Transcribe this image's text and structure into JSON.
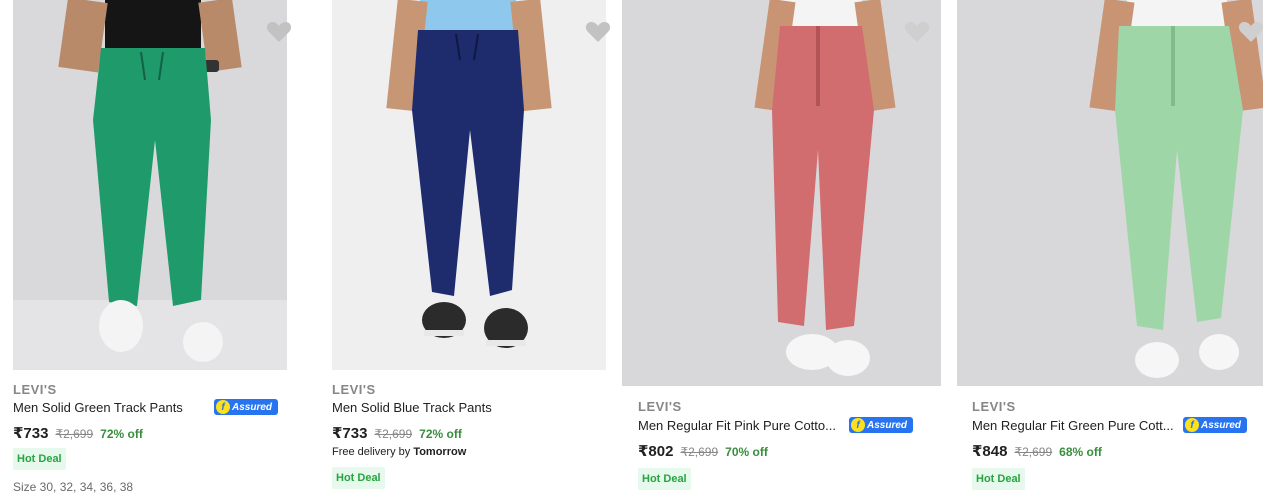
{
  "products": [
    {
      "brand": "LEVI'S",
      "title": "Men Solid Green Track Pants",
      "price": "₹733",
      "mrp": "₹2,699",
      "discount": "72% off",
      "assured": true,
      "deal": "Hot Deal",
      "sizes": "Size 30, 32, 34, 36, 38",
      "pant_color": "#1f9a6a"
    },
    {
      "brand": "LEVI'S",
      "title": "Men Solid Blue Track Pants",
      "price": "₹733",
      "mrp": "₹2,699",
      "discount": "72% off",
      "assured": false,
      "delivery_prefix": "Free delivery by ",
      "delivery_day": "Tomorrow",
      "deal": "Hot Deal",
      "pant_color": "#1e2c6e"
    },
    {
      "brand": "LEVI'S",
      "title": "Men Regular Fit Pink Pure Cotto...",
      "price": "₹802",
      "mrp": "₹2,699",
      "discount": "70% off",
      "assured": true,
      "deal": "Hot Deal",
      "pant_color": "#d26d6f"
    },
    {
      "brand": "LEVI'S",
      "title": "Men Regular Fit Green Pure Cott...",
      "price": "₹848",
      "mrp": "₹2,699",
      "discount": "68% off",
      "assured": true,
      "deal": "Hot Deal",
      "pant_color": "#9fd6a8"
    }
  ],
  "assured_badge": {
    "mark": "f",
    "label": "Assured"
  },
  "colors": {
    "accent": "#2874f0",
    "discount_green": "#388e3c",
    "hot_deal_bg": "#e7f8ec",
    "hot_deal_text": "#26a541"
  }
}
